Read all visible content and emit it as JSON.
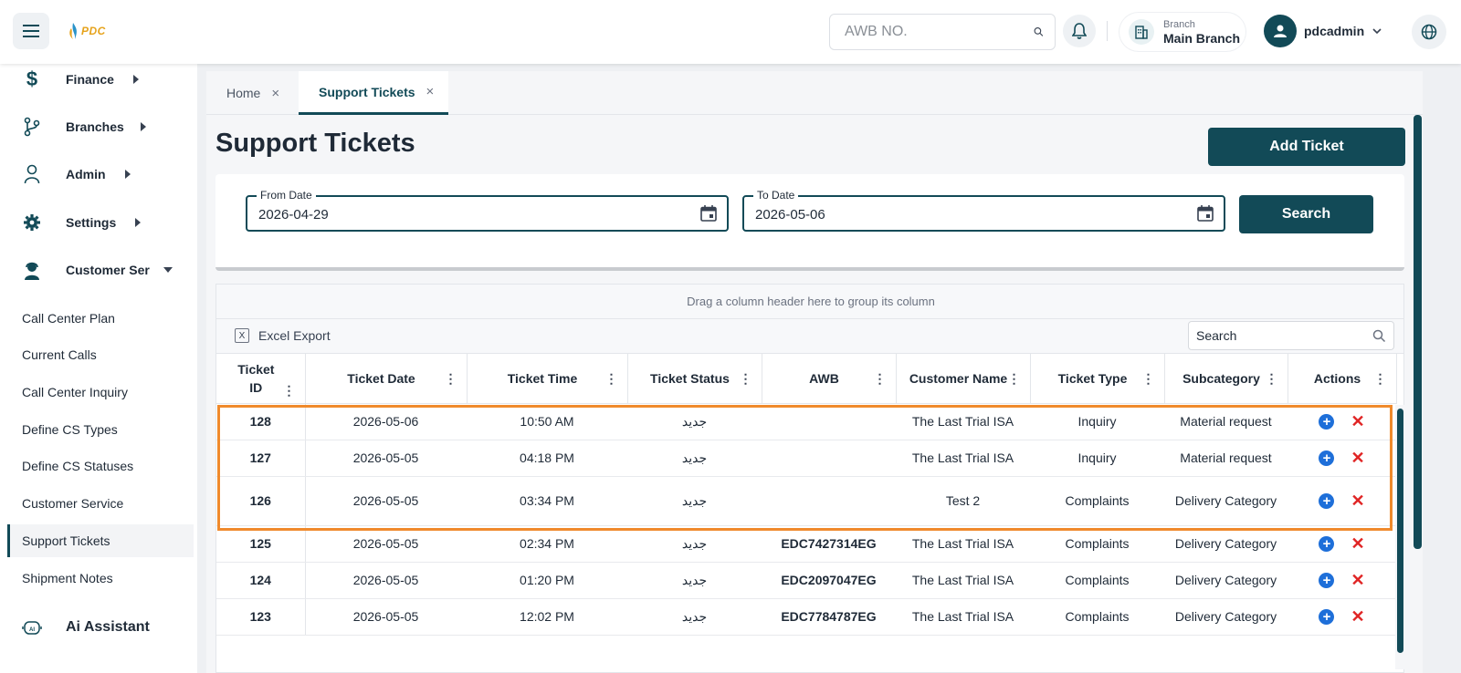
{
  "header": {
    "logo_text": "PDC",
    "awb_placeholder": "AWB NO.",
    "branch_label": "Branch",
    "branch_name": "Main Branch",
    "username": "pdcadmin"
  },
  "sidebar": {
    "main_items": [
      {
        "label": "Finance",
        "icon": "dollar-icon"
      },
      {
        "label": "Branches",
        "icon": "branch-fork-icon"
      },
      {
        "label": "Admin",
        "icon": "user-icon"
      },
      {
        "label": "Settings",
        "icon": "gear-icon"
      },
      {
        "label": "Customer Ser",
        "icon": "support-agent-icon"
      }
    ],
    "sub_items": [
      "Call Center Plan",
      "Current Calls",
      "Call Center Inquiry",
      "Define CS Types",
      "Define CS Statuses",
      "Customer Service",
      "Support Tickets",
      "Shipment Notes"
    ],
    "active_sub": "Support Tickets",
    "ai_assistant": "Ai Assistant"
  },
  "tabs": [
    {
      "label": "Home",
      "active": false
    },
    {
      "label": "Support Tickets",
      "active": true
    }
  ],
  "page": {
    "title": "Support Tickets",
    "add_button": "Add Ticket",
    "search_button": "Search"
  },
  "filters": {
    "from_label": "From Date",
    "from_value": "2026-04-29",
    "to_label": "To Date",
    "to_value": "2026-05-06"
  },
  "grid": {
    "group_panel_text": "Drag a column header here to group its column",
    "excel_export": "Excel Export",
    "search_placeholder": "Search",
    "columns": [
      "Ticket ID",
      "Ticket Date",
      "Ticket Time",
      "Ticket Status",
      "AWB",
      "Customer Name",
      "Ticket Type",
      "Subcategory",
      "Actions"
    ],
    "rows": [
      {
        "id": "128",
        "date": "2026-05-06",
        "time": "10:50 AM",
        "status": "جديد",
        "awb": "",
        "customer": "The Last Trial ISA",
        "type": "Inquiry",
        "subcategory": "Material request"
      },
      {
        "id": "127",
        "date": "2026-05-05",
        "time": "04:18 PM",
        "status": "جديد",
        "awb": "",
        "customer": "The Last Trial ISA",
        "type": "Inquiry",
        "subcategory": "Material request"
      },
      {
        "id": "126",
        "date": "2026-05-05",
        "time": "03:34 PM",
        "status": "جديد",
        "awb": "",
        "customer": "Test 2",
        "type": "Complaints",
        "subcategory": "Delivery Category"
      },
      {
        "id": "125",
        "date": "2026-05-05",
        "time": "02:34 PM",
        "status": "جديد",
        "awb": "EDC7427314EG",
        "customer": "The Last Trial ISA",
        "type": "Complaints",
        "subcategory": "Delivery Category"
      },
      {
        "id": "124",
        "date": "2026-05-05",
        "time": "01:20 PM",
        "status": "جديد",
        "awb": "EDC2097047EG",
        "customer": "The Last Trial ISA",
        "type": "Complaints",
        "subcategory": "Delivery Category"
      },
      {
        "id": "123",
        "date": "2026-05-05",
        "time": "12:02 PM",
        "status": "جديد",
        "awb": "EDC7784787EG",
        "customer": "The Last Trial ISA",
        "type": "Complaints",
        "subcategory": "Delivery Category"
      }
    ]
  },
  "colors": {
    "primary": "#124a57",
    "highlight": "#f08a2c",
    "add_icon": "#1e6fd9",
    "delete_icon": "#e02424"
  }
}
